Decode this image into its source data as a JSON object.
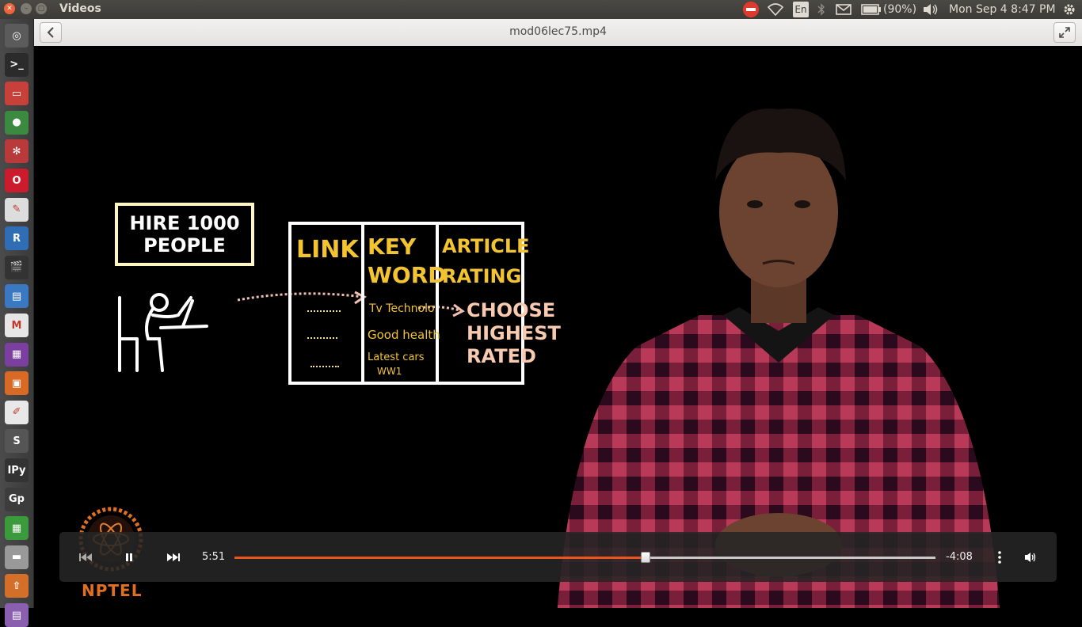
{
  "window": {
    "app_title": "Videos",
    "file_title": "mod06lec75.mp4"
  },
  "indicators": {
    "keyboard": "En",
    "battery": "(90%)",
    "clock": "Mon Sep  4  8:47 PM"
  },
  "launcher": {
    "items": [
      {
        "name": "dash-icon",
        "color": "#5b5b5b",
        "glyph": "◎"
      },
      {
        "name": "terminal-icon",
        "color": "#2b2b2b",
        "glyph": ">_"
      },
      {
        "name": "files-icon",
        "color": "#c8403a",
        "glyph": "▭"
      },
      {
        "name": "chrome-icon",
        "color": "#3b8a3f",
        "glyph": "●"
      },
      {
        "name": "settings-app-icon",
        "color": "#b83a3a",
        "glyph": "✻"
      },
      {
        "name": "opera-icon",
        "color": "#cc1b2c",
        "glyph": "O"
      },
      {
        "name": "document-viewer-icon",
        "color": "#ddd",
        "glyph": "✎"
      },
      {
        "name": "r-lang-icon",
        "color": "#2f6db5",
        "glyph": "R"
      },
      {
        "name": "video-editor-icon",
        "color": "#333",
        "glyph": "🎬"
      },
      {
        "name": "writer-icon",
        "color": "#3b78c2",
        "glyph": "▤"
      },
      {
        "name": "gmail-icon",
        "color": "#e6e6e6",
        "glyph": "M"
      },
      {
        "name": "media-icon",
        "color": "#7b3fa0",
        "glyph": "▦"
      },
      {
        "name": "impress-icon",
        "color": "#d86a25",
        "glyph": "▣"
      },
      {
        "name": "text-editor-icon",
        "color": "#e8e8e8",
        "glyph": "✐"
      },
      {
        "name": "sublime-icon",
        "color": "#555",
        "glyph": "S"
      },
      {
        "name": "ipython-icon",
        "color": "#333",
        "glyph": "IPy"
      },
      {
        "name": "gp-icon",
        "color": "#3c3c3c",
        "glyph": "Gp"
      },
      {
        "name": "calc-icon",
        "color": "#3b9a3b",
        "glyph": "▦"
      },
      {
        "name": "drive-icon",
        "color": "#999",
        "glyph": "▬"
      },
      {
        "name": "update-icon",
        "color": "#d46f2a",
        "glyph": "⇧"
      },
      {
        "name": "trash-icon",
        "color": "#8a5fb0",
        "glyph": "▤"
      }
    ]
  },
  "board": {
    "hire_box": "HIRE 1000\nPEOPLE",
    "col_link": "LINK",
    "col_keyword": "KEY\nWORD",
    "col_rating": "ARTICLE\nRATING",
    "kw_1": "Tv Technolo",
    "kw_2": "Good health",
    "kw_3": "Latest cars",
    "kw_4": "WW1",
    "choose": "CHOOSE\nHIGHEST\nRATED"
  },
  "logo": {
    "text": "NPTEL"
  },
  "player": {
    "elapsed": "5:51",
    "remaining": "-4:08",
    "progress_fraction": 0.586,
    "accent": "#e95420"
  }
}
